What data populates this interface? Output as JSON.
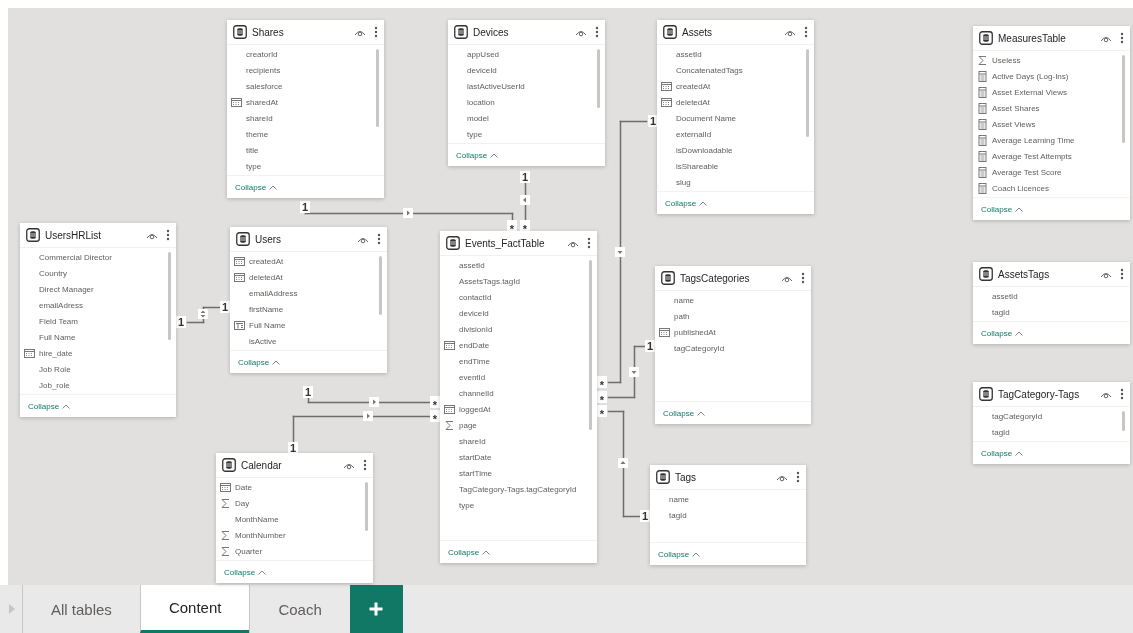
{
  "tables": [
    {
      "name": "Shares",
      "scrollbar": true,
      "fields": [
        {
          "label": "creatorId",
          "kind": "none"
        },
        {
          "label": "recipients",
          "kind": "none"
        },
        {
          "label": "salesforce",
          "kind": "none"
        },
        {
          "label": "sharedAt",
          "kind": "date"
        },
        {
          "label": "shareId",
          "kind": "none"
        },
        {
          "label": "theme",
          "kind": "none"
        },
        {
          "label": "title",
          "kind": "none"
        },
        {
          "label": "type",
          "kind": "none"
        }
      ],
      "collapse": "Collapse"
    },
    {
      "name": "Devices",
      "scrollbar": true,
      "fields": [
        {
          "label": "appUsed",
          "kind": "none"
        },
        {
          "label": "deviceId",
          "kind": "none"
        },
        {
          "label": "lastActiveUserId",
          "kind": "none"
        },
        {
          "label": "location",
          "kind": "none"
        },
        {
          "label": "model",
          "kind": "none"
        },
        {
          "label": "type",
          "kind": "none"
        }
      ],
      "collapse": "Collapse"
    },
    {
      "name": "Assets",
      "scrollbar": true,
      "fields": [
        {
          "label": "assetId",
          "kind": "none"
        },
        {
          "label": "ConcatenatedTags",
          "kind": "none"
        },
        {
          "label": "createdAt",
          "kind": "date"
        },
        {
          "label": "deletedAt",
          "kind": "date"
        },
        {
          "label": "Document Name",
          "kind": "none"
        },
        {
          "label": "externalId",
          "kind": "none"
        },
        {
          "label": "isDownloadable",
          "kind": "none"
        },
        {
          "label": "isShareable",
          "kind": "none"
        },
        {
          "label": "slug",
          "kind": "none"
        }
      ],
      "collapse": "Collapse"
    },
    {
      "name": "MeasuresTable",
      "scrollbar": true,
      "fields": [
        {
          "label": "Useless",
          "kind": "sum"
        },
        {
          "label": "Active Days (Log-Ins)",
          "kind": "measure"
        },
        {
          "label": "Asset External Views",
          "kind": "measure"
        },
        {
          "label": "Asset Shares",
          "kind": "measure"
        },
        {
          "label": "Asset Views",
          "kind": "measure"
        },
        {
          "label": "Average Learning Time",
          "kind": "measure"
        },
        {
          "label": "Average Test Attempts",
          "kind": "measure"
        },
        {
          "label": "Average Test Score",
          "kind": "measure"
        },
        {
          "label": "Coach Licences",
          "kind": "measure"
        }
      ],
      "collapse": "Collapse"
    },
    {
      "name": "UsersHRList",
      "scrollbar": true,
      "fields": [
        {
          "label": "Commercial Director",
          "kind": "none"
        },
        {
          "label": "Country",
          "kind": "none"
        },
        {
          "label": "Direct Manager",
          "kind": "none"
        },
        {
          "label": "emailAdress",
          "kind": "none"
        },
        {
          "label": "Field Team",
          "kind": "none"
        },
        {
          "label": "Full Name",
          "kind": "none"
        },
        {
          "label": "hire_date",
          "kind": "date"
        },
        {
          "label": "Job Role",
          "kind": "none"
        },
        {
          "label": "Job_role",
          "kind": "none"
        }
      ],
      "collapse": "Collapse"
    },
    {
      "name": "Users",
      "scrollbar": true,
      "fields": [
        {
          "label": "createdAt",
          "kind": "date"
        },
        {
          "label": "deletedAt",
          "kind": "date"
        },
        {
          "label": "emailAddress",
          "kind": "none"
        },
        {
          "label": "firstName",
          "kind": "none"
        },
        {
          "label": "Full Name",
          "kind": "calculated"
        },
        {
          "label": "isActive",
          "kind": "none"
        }
      ],
      "collapse": "Collapse"
    },
    {
      "name": "Events_FactTable",
      "scrollbar": true,
      "fields": [
        {
          "label": "assetId",
          "kind": "none"
        },
        {
          "label": "AssetsTags.tagId",
          "kind": "none"
        },
        {
          "label": "contactId",
          "kind": "none"
        },
        {
          "label": "deviceId",
          "kind": "none"
        },
        {
          "label": "divisionId",
          "kind": "none"
        },
        {
          "label": "endDate",
          "kind": "date"
        },
        {
          "label": "endTime",
          "kind": "none"
        },
        {
          "label": "eventId",
          "kind": "none"
        },
        {
          "label": "channelId",
          "kind": "none"
        },
        {
          "label": "loggedAt",
          "kind": "date"
        },
        {
          "label": "page",
          "kind": "sum"
        },
        {
          "label": "shareId",
          "kind": "none"
        },
        {
          "label": "startDate",
          "kind": "none"
        },
        {
          "label": "startTime",
          "kind": "none"
        },
        {
          "label": "TagCategory-Tags.tagCategoryId",
          "kind": "none"
        },
        {
          "label": "type",
          "kind": "none"
        }
      ],
      "collapse": "Collapse"
    },
    {
      "name": "TagsCategories",
      "scrollbar": false,
      "fields": [
        {
          "label": "name",
          "kind": "none"
        },
        {
          "label": "path",
          "kind": "none"
        },
        {
          "label": "publishedAt",
          "kind": "date"
        },
        {
          "label": "tagCategoryId",
          "kind": "none"
        }
      ],
      "collapse": "Collapse"
    },
    {
      "name": "AssetsTags",
      "scrollbar": false,
      "fields": [
        {
          "label": "assetId",
          "kind": "none"
        },
        {
          "label": "tagId",
          "kind": "none"
        }
      ],
      "collapse": "Collapse"
    },
    {
      "name": "TagCategory-Tags",
      "scrollbar": true,
      "fields": [
        {
          "label": "tagCategoryId",
          "kind": "none"
        },
        {
          "label": "tagId",
          "kind": "none"
        }
      ],
      "collapse": "Collapse"
    },
    {
      "name": "Calendar",
      "scrollbar": true,
      "fields": [
        {
          "label": "Date",
          "kind": "date"
        },
        {
          "label": "Day",
          "kind": "sum"
        },
        {
          "label": "MonthName",
          "kind": "none"
        },
        {
          "label": "MonthNumber",
          "kind": "sum"
        },
        {
          "label": "Quarter",
          "kind": "sum"
        }
      ],
      "collapse": "Collapse"
    },
    {
      "name": "Tags",
      "scrollbar": false,
      "fields": [
        {
          "label": "name",
          "kind": "none"
        },
        {
          "label": "tagId",
          "kind": "none"
        }
      ],
      "collapse": "Collapse"
    }
  ],
  "relationships": [
    {
      "from_end": "1",
      "to_end": "*",
      "kind": "right"
    },
    {
      "from_end": "1",
      "to_end": "*",
      "kind": "left"
    },
    {
      "from_end": "1",
      "to_end": "*",
      "kind": "down"
    },
    {
      "from_end": "1",
      "to_end": "*",
      "kind": "down"
    },
    {
      "from_end": "1",
      "to_end": "*",
      "kind": "up"
    },
    {
      "from_end": "1",
      "to_end": "1",
      "kind": "both"
    },
    {
      "from_end": "1",
      "to_end": "*",
      "kind": "right"
    },
    {
      "from_end": "1",
      "to_end": "*",
      "kind": "right"
    }
  ],
  "tabs": [
    {
      "label": "All tables",
      "selected": false
    },
    {
      "label": "Content",
      "selected": true
    },
    {
      "label": "Coach",
      "selected": false
    }
  ]
}
